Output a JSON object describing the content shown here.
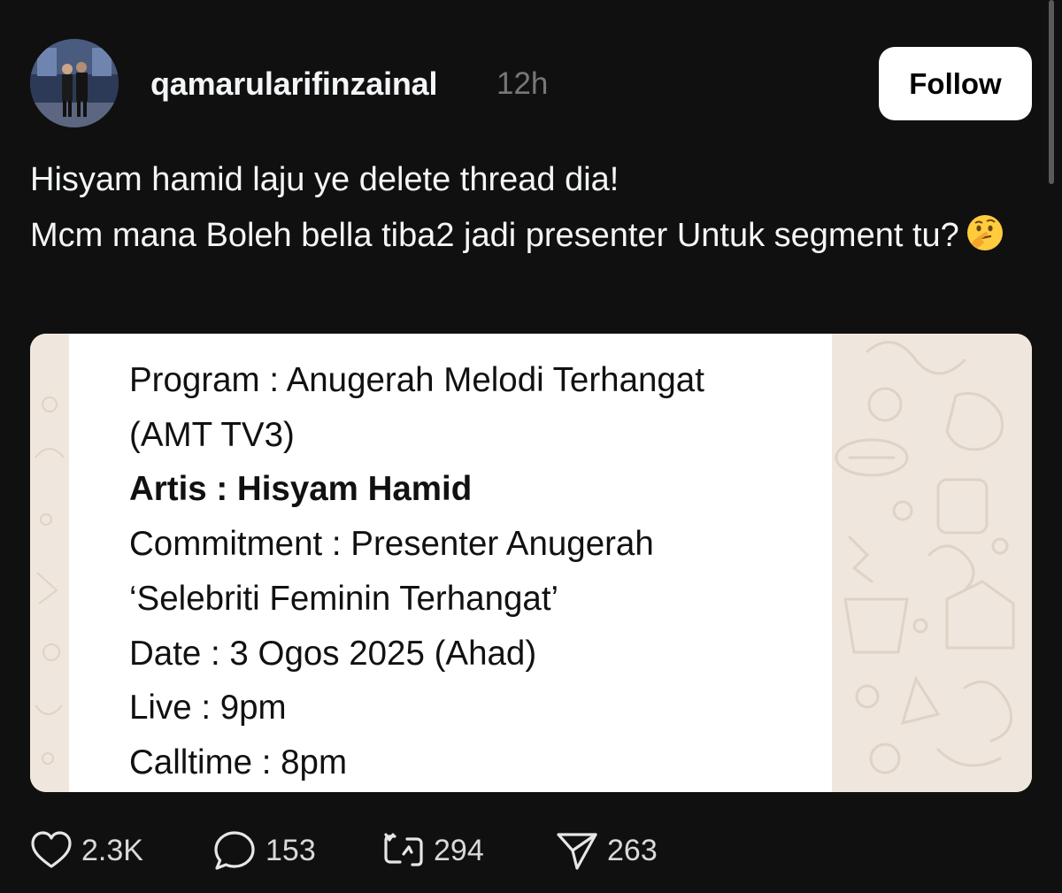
{
  "post": {
    "username": "qamarularifinzainal",
    "time": "12h",
    "follow_label": "Follow",
    "text_lines": [
      "Hisyam hamid laju ye delete thread dia!",
      "Mcm mana Boleh bella tiba2 jadi presenter Untuk segment tu?"
    ],
    "emoji": "thinking-face-emoji"
  },
  "image": {
    "lines": [
      "Program : Anugerah Melodi Terhangat",
      "(AMT TV3)",
      "Artis : Hisyam Hamid",
      "Commitment : Presenter Anugerah",
      "‘Selebriti Feminin Terhangat’",
      "Date : 3 Ogos 2025 (Ahad)",
      "Live : 9pm",
      "Calltime : 8pm"
    ]
  },
  "actions": {
    "likes": "2.3K",
    "replies": "153",
    "reposts": "294",
    "shares": "263"
  },
  "colors": {
    "background": "#101010",
    "follow_bg": "#ffffff",
    "muted": "#777777",
    "chat_wallpaper": "#efe7dd"
  }
}
